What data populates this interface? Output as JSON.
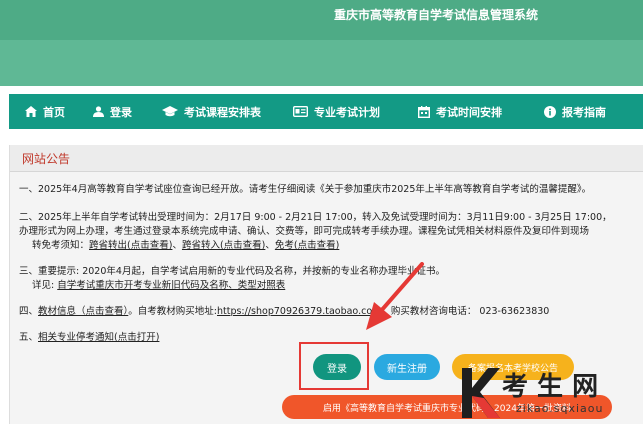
{
  "site": {
    "title": "重庆市高等教育自学考试信息管理系统"
  },
  "nav": [
    {
      "label": "首页",
      "icon": "home-icon"
    },
    {
      "label": "登录",
      "icon": "user-icon"
    },
    {
      "label": "考试课程安排表",
      "icon": "graduation-cap-icon"
    },
    {
      "label": "专业考试计划",
      "icon": "id-card-icon"
    },
    {
      "label": "考试时间安排",
      "icon": "calendar-icon"
    },
    {
      "label": "报考指南",
      "icon": "info-icon"
    }
  ],
  "notice": {
    "title": "网站公告",
    "l1": "一、2025年4月高等教育自学考试座位查询已经开放。请考生仔细阅读《关于参加重庆市2025年上半年高等教育自学考试的温馨提醒》。",
    "l2a": "二、2025年上半年自学考试转出受理时间为：2月17日 9:00 - 2月21日 17:00，转入及免试受理时间为：3月11日9:00 - 3月25日 17:00，",
    "l2b": "办理形式为网上办理，考生通过登录本系统完成申请、确认、交费等，即可完成转考手续办理。课程免试凭相关材料原件及复印件到现场",
    "l2c_prefix": "转免考须知：",
    "l2c_link1": "跨省转出(点击查看)",
    "l2c_sep1": "、",
    "l2c_link2": "跨省转入(点击查看)",
    "l2c_sep2": "、",
    "l2c_link3": "免考(点击查看)",
    "l3a": "三、重要提示: 2020年4月起，自学考试启用新的专业代码及名称，并按新的专业名称办理毕业证书。",
    "l3b_prefix": "详见: ",
    "l3b_link": "自学考试重庆市开考专业新旧代码及名称、类型对照表",
    "l4_prefix": "四、",
    "l4_link": "教材信息（点击查看）",
    "l4_mid": "。自考教材购买地址:",
    "l4_url": "https://shop70926379.taobao.com",
    "l4_tail": "，购买教材咨询电话： 023-63623830",
    "l5_prefix": "五、",
    "l5_link": "相关专业停考通知(点击打开)"
  },
  "buttons": {
    "login": "登录",
    "register": "新生注册",
    "yellow": "备案报名本考学校公告",
    "orange": "启用《高等教育自学考试重庆市专业代码》2024年第一批资料"
  },
  "watermark": {
    "k": "K",
    "text": "考 生 网",
    "domain": "zikao.sqxiaou"
  },
  "colors": {
    "nav": "#139a85",
    "header": "#4eab86",
    "login": "#11957f",
    "register": "#2aa9e0",
    "yellow": "#f6b21c",
    "orange": "#f0562a"
  }
}
